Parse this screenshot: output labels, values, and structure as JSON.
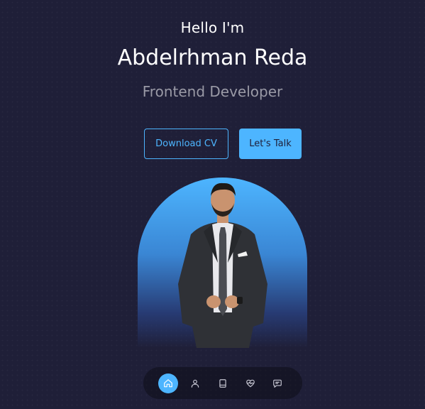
{
  "header": {
    "greeting": "Hello I'm",
    "name": "Abdelrhman Reda",
    "role": "Frontend Developer"
  },
  "cta": {
    "download_label": "Download CV",
    "talk_label": "Let's Talk"
  },
  "nav": {
    "items": [
      {
        "icon": "home-icon",
        "active": true
      },
      {
        "icon": "user-icon",
        "active": false
      },
      {
        "icon": "book-icon",
        "active": false
      },
      {
        "icon": "heart-pulse-icon",
        "active": false
      },
      {
        "icon": "message-icon",
        "active": false
      }
    ]
  },
  "colors": {
    "background": "#1f1f38",
    "accent": "#4db5ff",
    "muted_text": "#9a9aa6"
  }
}
